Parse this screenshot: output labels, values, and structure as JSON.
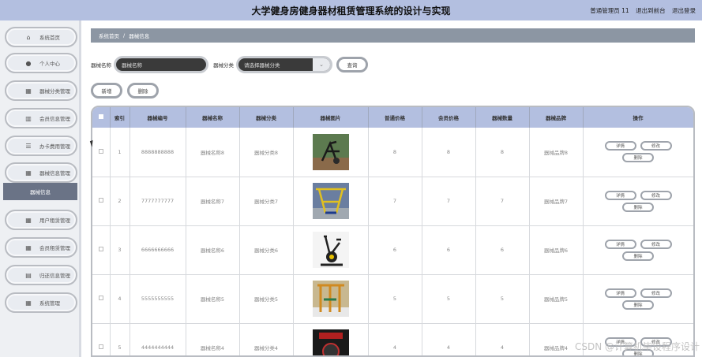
{
  "header": {
    "title": "大学健身房健身器材租赁管理系统的设计与实现",
    "user": "普通管理员 11",
    "to_frontend": "退出到前台",
    "logout": "退出登录"
  },
  "sidebar": {
    "items": [
      {
        "label": "系统首页",
        "icon": "home-icon"
      },
      {
        "label": "个人中心",
        "icon": "user-icon"
      },
      {
        "label": "器械分类管理",
        "icon": "grid-icon"
      },
      {
        "label": "会员信息管理",
        "icon": "chart-icon"
      },
      {
        "label": "办卡费用管理",
        "icon": "list-icon"
      },
      {
        "label": "器械信息管理",
        "icon": "grid-icon"
      },
      {
        "label": "用户租赁管理",
        "icon": "grid-icon"
      },
      {
        "label": "会员租赁管理",
        "icon": "grid-icon"
      },
      {
        "label": "归还信息管理",
        "icon": "doc-icon"
      },
      {
        "label": "系统管理",
        "icon": "grid-icon"
      }
    ],
    "active_sub": "器械信息"
  },
  "breadcrumb": {
    "home": "系统首页",
    "sep": "/",
    "current": "器械信息"
  },
  "search": {
    "name_label": "器械名称",
    "name_placeholder": "器械名称",
    "category_label": "器械分类",
    "category_placeholder": "请选择器械分类",
    "query_button": "查询"
  },
  "actions": {
    "add": "新增",
    "delete": "删除"
  },
  "table": {
    "headers": [
      "索引",
      "器械编号",
      "器械名称",
      "器械分类",
      "器械图片",
      "普通价格",
      "会员价格",
      "器械数量",
      "器械品牌",
      "操作"
    ],
    "op_labels": {
      "detail": "详情",
      "edit": "修改",
      "delete": "删除"
    },
    "rows": [
      {
        "index": "1",
        "code": "8888888888",
        "name": "器械名称8",
        "category": "器械分类8",
        "price": "8",
        "member_price": "8",
        "qty": "8",
        "brand": "器械品牌8"
      },
      {
        "index": "2",
        "code": "7777777777",
        "name": "器械名称7",
        "category": "器械分类7",
        "price": "7",
        "member_price": "7",
        "qty": "7",
        "brand": "器械品牌7"
      },
      {
        "index": "3",
        "code": "6666666666",
        "name": "器械名称6",
        "category": "器械分类6",
        "price": "6",
        "member_price": "6",
        "qty": "6",
        "brand": "器械品牌6"
      },
      {
        "index": "4",
        "code": "5555555555",
        "name": "器械名称5",
        "category": "器械分类5",
        "price": "5",
        "member_price": "5",
        "qty": "5",
        "brand": "器械品牌5"
      },
      {
        "index": "5",
        "code": "4444444444",
        "name": "器械名称4",
        "category": "器械分类4",
        "price": "4",
        "member_price": "4",
        "qty": "4",
        "brand": "器械品牌4"
      }
    ]
  },
  "watermark": "CSDN @计算机毕设程序设计"
}
